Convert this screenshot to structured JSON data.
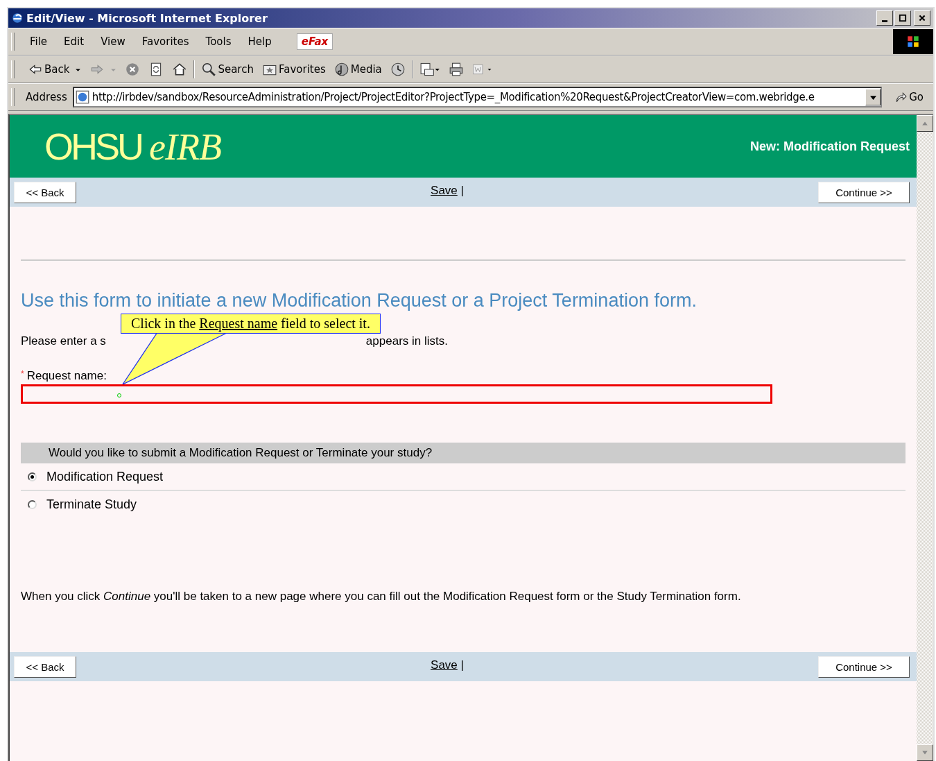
{
  "window": {
    "title": "Edit/View - Microsoft Internet Explorer"
  },
  "menu": {
    "items": [
      "File",
      "Edit",
      "View",
      "Favorites",
      "Tools",
      "Help"
    ],
    "badge": "eFax"
  },
  "toolbar": [
    {
      "kind": "back",
      "label": "Back"
    },
    {
      "kind": "forward"
    },
    {
      "kind": "stop"
    },
    {
      "kind": "refresh"
    },
    {
      "kind": "home"
    },
    {
      "kind": "search",
      "label": "Search"
    },
    {
      "kind": "favorites",
      "label": "Favorites"
    },
    {
      "kind": "media",
      "label": "Media"
    },
    {
      "kind": "history"
    },
    {
      "kind": "mail"
    },
    {
      "kind": "print"
    },
    {
      "kind": "edit"
    }
  ],
  "address": {
    "label": "Address",
    "value": "http://irbdev/sandbox/ResourceAdministration/Project/ProjectEditor?ProjectType=_Modification%20Request&ProjectCreatorView=com.webridge.e",
    "go": "Go"
  },
  "header": {
    "logo": "OHSU",
    "logo_italic": "eIRB",
    "page_title": "New: Modification Request"
  },
  "nav_bars": [
    {
      "back": "<< Back",
      "save": "Save",
      "separator": "|",
      "continue": "Continue >>"
    },
    {
      "back": "<< Back",
      "save": "Save",
      "separator": "|",
      "continue": "Continue >>"
    }
  ],
  "form": {
    "heading": "Use this form to initiate a new Modification Request or a Project Termination form.",
    "help_start": "Please enter a s",
    "help_end": "appears in lists.",
    "tooltip": {
      "before": "Click in the ",
      "link": "Request name",
      "after": " field to select it."
    },
    "field": {
      "required_mark": "*",
      "label": "Request name:",
      "error": true
    },
    "question": {
      "text": "Would you like to submit a Modification Request or Terminate your study?",
      "options": [
        {
          "label": "Modification Request",
          "selected": true
        },
        {
          "label": "Terminate Study",
          "selected": false
        }
      ]
    },
    "note": "When you click *Continue* you'll be taken to a new page where you can fill out the Modification Request form or the Study Termination form."
  }
}
